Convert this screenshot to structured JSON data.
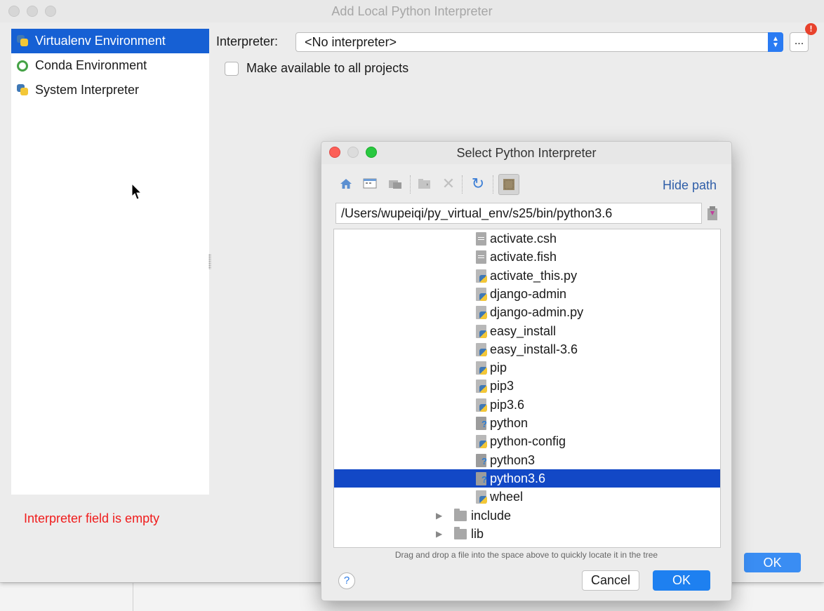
{
  "window": {
    "title": "Add Local Python Interpreter"
  },
  "sidebar": {
    "items": [
      {
        "label": "Virtualenv Environment",
        "icon": "python-icon",
        "selected": true
      },
      {
        "label": "Conda Environment",
        "icon": "conda-icon",
        "selected": false
      },
      {
        "label": "System Interpreter",
        "icon": "python-icon",
        "selected": false
      }
    ]
  },
  "form": {
    "interpreter_label": "Interpreter:",
    "interpreter_value": "<No interpreter>",
    "browse_label": "...",
    "warning_badge": "!",
    "make_available_label": "Make available to all projects",
    "make_available_checked": false
  },
  "error": {
    "message": "Interpreter field is empty",
    "color": "#f01c1c"
  },
  "footer": {
    "ok_label": "OK"
  },
  "dialog": {
    "title": "Select Python Interpreter",
    "hide_path_label": "Hide path",
    "path_value": "/Users/wupeiqi/py_virtual_env/s25/bin/python3.6",
    "toolbar": [
      "home-icon",
      "desktop-icon",
      "project-icon",
      "new-folder-icon",
      "delete-icon",
      "refresh-icon",
      "show-hidden-icon"
    ],
    "tree": [
      {
        "label": "activate.csh",
        "type": "doc"
      },
      {
        "label": "activate.fish",
        "type": "doc"
      },
      {
        "label": "activate_this.py",
        "type": "python"
      },
      {
        "label": "django-admin",
        "type": "python"
      },
      {
        "label": "django-admin.py",
        "type": "python"
      },
      {
        "label": "easy_install",
        "type": "python"
      },
      {
        "label": "easy_install-3.6",
        "type": "python"
      },
      {
        "label": "pip",
        "type": "python"
      },
      {
        "label": "pip3",
        "type": "python"
      },
      {
        "label": "pip3.6",
        "type": "python"
      },
      {
        "label": "python",
        "type": "unknown"
      },
      {
        "label": "python-config",
        "type": "python"
      },
      {
        "label": "python3",
        "type": "unknown"
      },
      {
        "label": "python3.6",
        "type": "unknown",
        "selected": true
      },
      {
        "label": "wheel",
        "type": "python"
      },
      {
        "label": "include",
        "type": "folder"
      },
      {
        "label": "lib",
        "type": "folder"
      }
    ],
    "drag_hint": "Drag and drop a file into the space above to quickly locate it in the tree",
    "help_label": "?",
    "cancel_label": "Cancel",
    "ok_label": "OK"
  },
  "colors": {
    "selection": "#1660d4",
    "accent": "#1e80f0",
    "link": "#2f5ea8"
  }
}
